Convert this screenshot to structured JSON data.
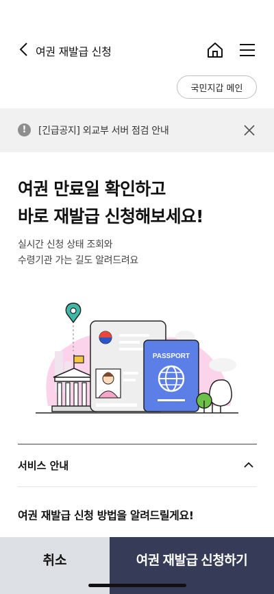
{
  "header": {
    "title": "여권 재발급 신청",
    "back_icon": "chevron-left-icon",
    "home_icon": "home-icon",
    "menu_icon": "hamburger-menu-icon"
  },
  "main_link": {
    "label": "국민지갑 메인"
  },
  "notice": {
    "text": "[긴급공지] 외교부 서버 점검 안내",
    "icon": "exclamation-circle-icon",
    "close_icon": "close-icon"
  },
  "hero": {
    "headline": [
      "여권 만료일 확인하고",
      "바로 재발급 신청해보세요!"
    ],
    "subtext": [
      "실시간 신청 상태 조회와",
      "수령기관 가는 길도 알려드려요"
    ]
  },
  "illustration": {
    "passport_label": "PASSPORT",
    "colors": {
      "passport": "#5b7fe6",
      "bubble": "#f9c9e6",
      "card": "#eeeeee",
      "pin": "#3fb8a8",
      "flag": "#f5c842",
      "tree": "#6cc04a"
    }
  },
  "service": {
    "label": "서비스 안내",
    "howto": "여권 재발급 신청 방법을 알려드릴게요!"
  },
  "bottom": {
    "cancel_label": "취소",
    "apply_label": "여권 재발급 신청하기",
    "colors": {
      "cancel_bg": "#dde1e6",
      "apply_bg": "#363c57"
    }
  }
}
